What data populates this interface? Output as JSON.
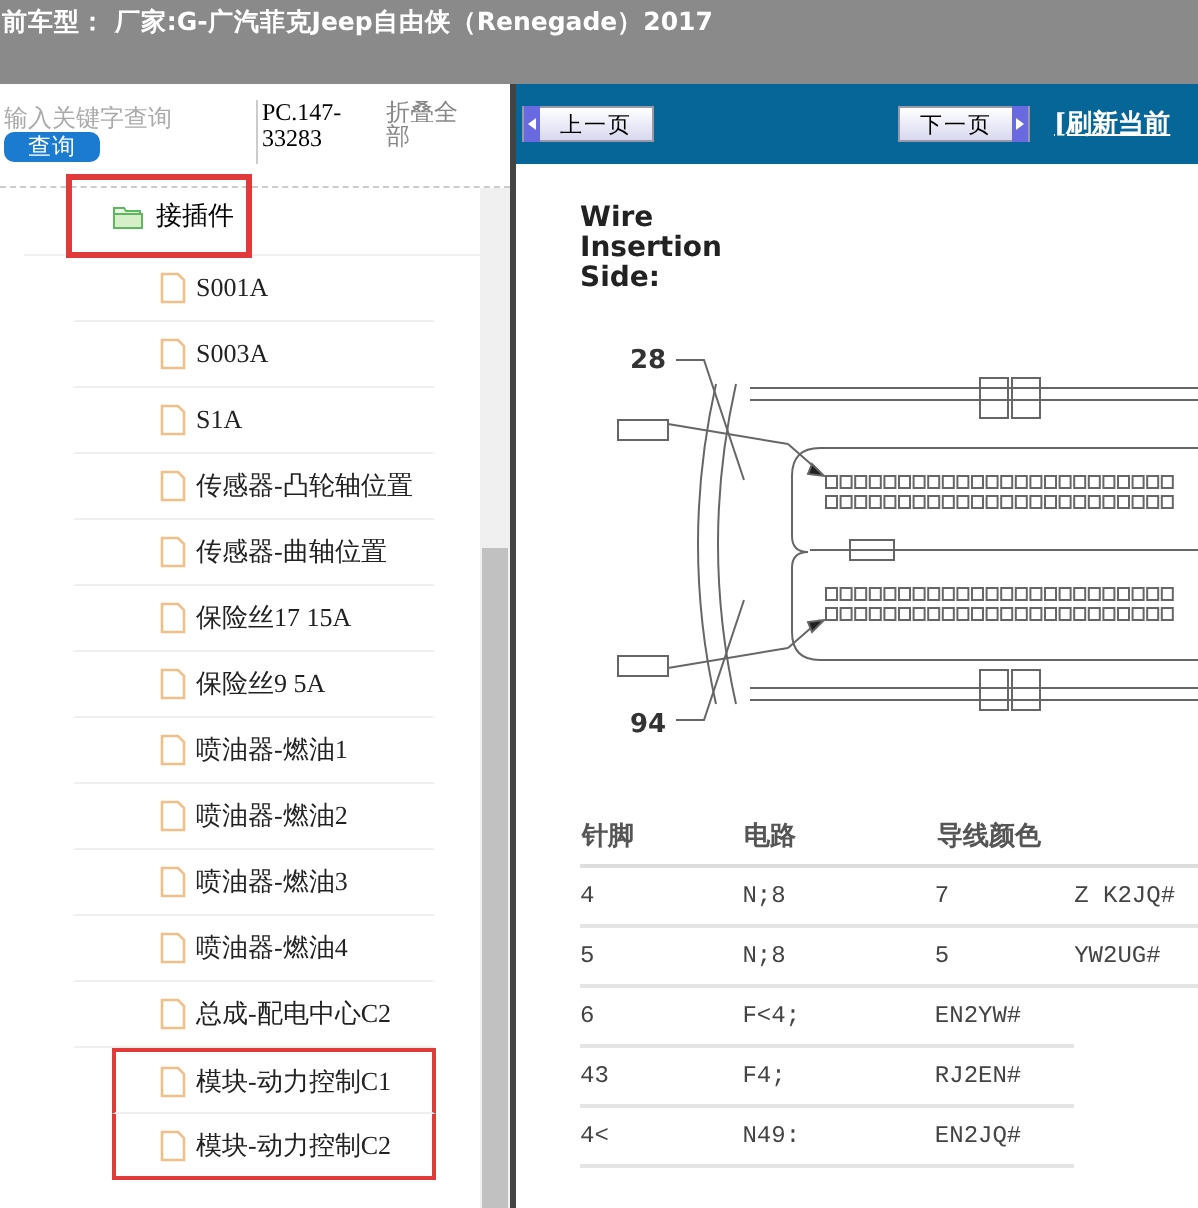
{
  "title_bar": {
    "text": "前车型： 厂家:G-广汽菲克Jeep自由侠（Renegade）2017"
  },
  "sidebar": {
    "search": {
      "placeholder": "输入关键字查询",
      "button": "查询"
    },
    "code": "PC.147-33283",
    "collapse": "折叠全部",
    "tree": [
      {
        "label": "接插件",
        "kind": "folder",
        "highlighted": true,
        "children": [
          {
            "label": "S001A",
            "kind": "file",
            "highlighted": false
          },
          {
            "label": "S003A",
            "kind": "file",
            "highlighted": false
          },
          {
            "label": "S1A",
            "kind": "file",
            "highlighted": false
          },
          {
            "label": "传感器-凸轮轴位置",
            "kind": "file",
            "highlighted": false
          },
          {
            "label": "传感器-曲轴位置",
            "kind": "file",
            "highlighted": false
          },
          {
            "label": "保险丝17 15A",
            "kind": "file",
            "highlighted": false
          },
          {
            "label": "保险丝9 5A",
            "kind": "file",
            "highlighted": false
          },
          {
            "label": "喷油器-燃油1",
            "kind": "file",
            "highlighted": false
          },
          {
            "label": "喷油器-燃油2",
            "kind": "file",
            "highlighted": false
          },
          {
            "label": "喷油器-燃油3",
            "kind": "file",
            "highlighted": false
          },
          {
            "label": "喷油器-燃油4",
            "kind": "file",
            "highlighted": false
          },
          {
            "label": "总成-配电中心C2",
            "kind": "file",
            "highlighted": false
          },
          {
            "label": "模块-动力控制C1",
            "kind": "file",
            "highlighted": true
          },
          {
            "label": "模块-动力控制C2",
            "kind": "file",
            "highlighted": true
          }
        ]
      }
    ]
  },
  "toolbar": {
    "prev": "上一页",
    "next": "下一页",
    "refresh": "[刷新当前"
  },
  "document": {
    "heading": [
      "Wire",
      "Insertion",
      "Side:"
    ],
    "pin_labels": [
      "28",
      "94"
    ],
    "table": {
      "columns": [
        "针脚",
        "电路",
        "导线颜色"
      ],
      "rows": [
        [
          "4",
          "N;8",
          "7",
          "Z K2JQ#"
        ],
        [
          "5",
          "N;8",
          "5",
          "YW2UG#"
        ],
        [
          "6",
          "F<4;",
          "EN2YW#"
        ],
        [
          "43",
          "F4;",
          "RJ2EN#"
        ],
        [
          "4<",
          "N49:",
          "EN2JQ#"
        ]
      ]
    }
  }
}
